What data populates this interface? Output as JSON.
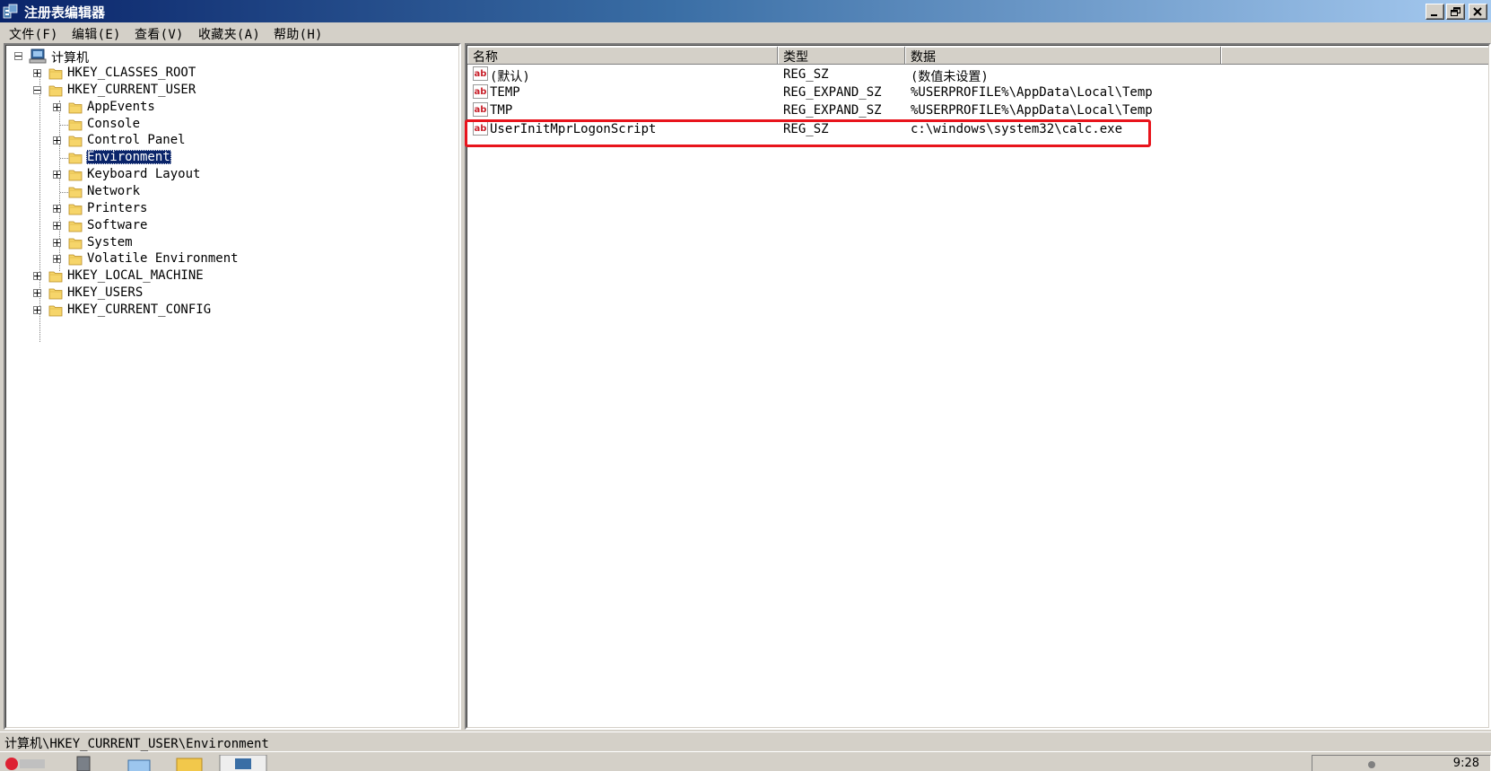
{
  "window": {
    "title": "注册表编辑器"
  },
  "menu": [
    "文件(F)",
    "编辑(E)",
    "查看(V)",
    "收藏夹(A)",
    "帮助(H)"
  ],
  "tree": {
    "root": "计算机",
    "nodes": [
      {
        "label": "HKEY_CLASSES_ROOT",
        "level": 1,
        "expander": "plus"
      },
      {
        "label": "HKEY_CURRENT_USER",
        "level": 1,
        "expander": "minus"
      },
      {
        "label": "AppEvents",
        "level": 2,
        "expander": "plus"
      },
      {
        "label": "Console",
        "level": 2,
        "expander": "none"
      },
      {
        "label": "Control Panel",
        "level": 2,
        "expander": "plus"
      },
      {
        "label": "Environment",
        "level": 2,
        "expander": "none",
        "selected": true
      },
      {
        "label": "Keyboard Layout",
        "level": 2,
        "expander": "plus"
      },
      {
        "label": "Network",
        "level": 2,
        "expander": "none"
      },
      {
        "label": "Printers",
        "level": 2,
        "expander": "plus"
      },
      {
        "label": "Software",
        "level": 2,
        "expander": "plus"
      },
      {
        "label": "System",
        "level": 2,
        "expander": "plus"
      },
      {
        "label": "Volatile Environment",
        "level": 2,
        "expander": "plus"
      },
      {
        "label": "HKEY_LOCAL_MACHINE",
        "level": 1,
        "expander": "plus"
      },
      {
        "label": "HKEY_USERS",
        "level": 1,
        "expander": "plus"
      },
      {
        "label": "HKEY_CURRENT_CONFIG",
        "level": 1,
        "expander": "plus"
      }
    ]
  },
  "list": {
    "columns": [
      "名称",
      "类型",
      "数据"
    ],
    "rows": [
      {
        "name": "(默认)",
        "type": "REG_SZ",
        "data": "(数值未设置)"
      },
      {
        "name": "TEMP",
        "type": "REG_EXPAND_SZ",
        "data": "%USERPROFILE%\\AppData\\Local\\Temp"
      },
      {
        "name": "TMP",
        "type": "REG_EXPAND_SZ",
        "data": "%USERPROFILE%\\AppData\\Local\\Temp"
      },
      {
        "name": "UserInitMprLogonScript",
        "type": "REG_SZ",
        "data": "c:\\windows\\system32\\calc.exe",
        "highlighted": true
      }
    ]
  },
  "status": {
    "path": "计算机\\HKEY_CURRENT_USER\\Environment"
  },
  "taskbar": {
    "clock": "9:28"
  },
  "colors": {
    "highlight_box": "#e8141c",
    "selection": "#0a246a",
    "title_start": "#0a246a",
    "title_end": "#a6caf0"
  }
}
